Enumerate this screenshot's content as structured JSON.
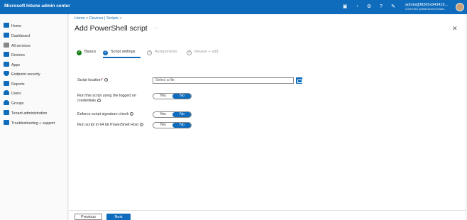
{
  "topbar": {
    "title": "Microsoft Intune admin center",
    "account_name": "admin@M365x943419...",
    "account_org": "CONTOSO (M365X943419.ONMI...",
    "icons": [
      "remote-icon",
      "bell-icon",
      "settings-icon",
      "help-icon",
      "feedback-icon"
    ]
  },
  "sidebar": {
    "items": [
      {
        "label": "Home",
        "icon": "home-icon",
        "color": "#0f6cbd"
      },
      {
        "label": "Dashboard",
        "icon": "dashboard-icon",
        "color": "#0f6cbd"
      },
      {
        "label": "All services",
        "icon": "all-services-icon",
        "color": "#605e5c"
      },
      {
        "label": "Devices",
        "icon": "devices-icon",
        "color": "#0f6cbd"
      },
      {
        "label": "Apps",
        "icon": "apps-icon",
        "color": "#0f6cbd"
      },
      {
        "label": "Endpoint security",
        "icon": "endpoint-security-icon",
        "color": "#0f6cbd"
      },
      {
        "label": "Reports",
        "icon": "reports-icon",
        "color": "#0f6cbd"
      },
      {
        "label": "Users",
        "icon": "users-icon",
        "color": "#0f6cbd"
      },
      {
        "label": "Groups",
        "icon": "groups-icon",
        "color": "#0f6cbd"
      },
      {
        "label": "Tenant administration",
        "icon": "tenant-admin-icon",
        "color": "#0f6cbd"
      },
      {
        "label": "Troubleshooting + support",
        "icon": "troubleshooting-icon",
        "color": "#0f6cbd"
      }
    ]
  },
  "breadcrumb": {
    "home": "Home",
    "sep": ">",
    "devices": "Devices | Scripts",
    "trail": ">"
  },
  "page": {
    "title": "Add PowerShell script",
    "more": "···",
    "close": "✕"
  },
  "steps": [
    {
      "label": "Basics",
      "state": "done",
      "marker": "✓"
    },
    {
      "label": "Script settings",
      "state": "active",
      "marker": "2"
    },
    {
      "label": "Assignments",
      "state": "inactive",
      "marker": "3"
    },
    {
      "label": "Review + add",
      "state": "inactive",
      "marker": "4"
    }
  ],
  "form": {
    "script_location": {
      "label": "Script location",
      "required": "*",
      "placeholder": "Select a file"
    },
    "run_as_logged_on": {
      "label_line1": "Run this script using the logged on",
      "label_line2": "credentials",
      "yes": "Yes",
      "no": "No",
      "value": "No"
    },
    "enforce_signature": {
      "label": "Enforce script signature check",
      "yes": "Yes",
      "no": "No",
      "value": "No"
    },
    "run_64bit": {
      "label": "Run script in 64 bit PowerShell Host",
      "yes": "Yes",
      "no": "No",
      "value": "No"
    }
  },
  "footer": {
    "previous": "Previous",
    "next": "Next"
  },
  "colors": {
    "accent": "#0f6cbd",
    "success": "#107c10",
    "required": "#a4262c"
  }
}
